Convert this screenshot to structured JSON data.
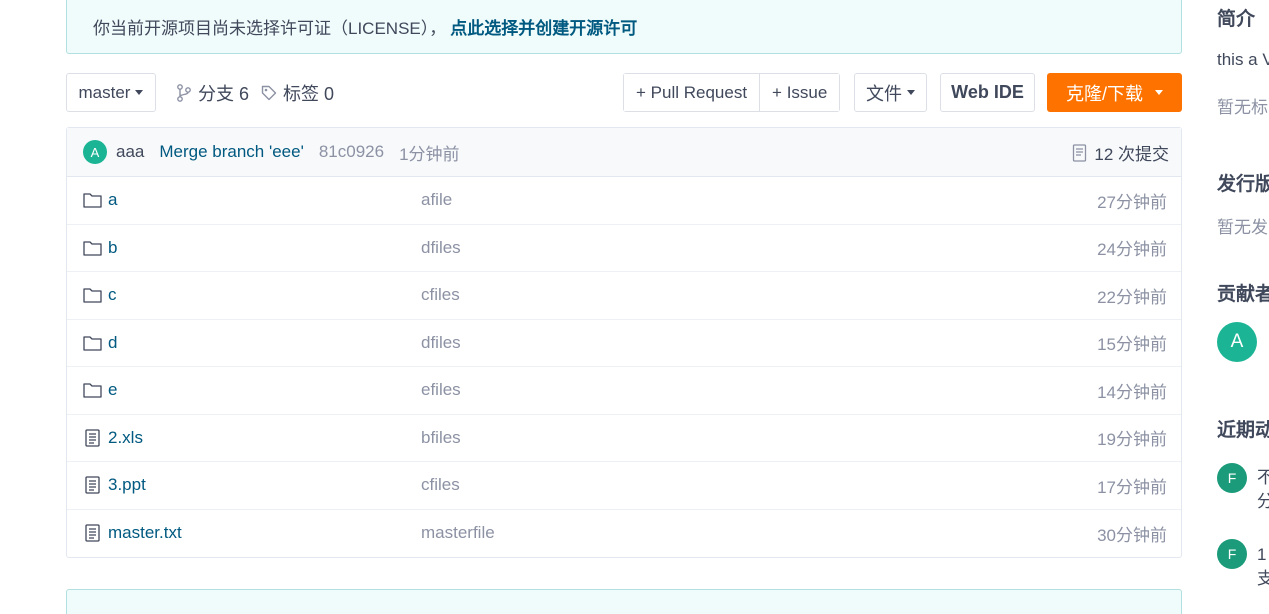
{
  "license_banner": {
    "message": "你当前开源项目尚未选择许可证（LICENSE），",
    "link": "点此选择并创建开源许可"
  },
  "toolbar": {
    "branch": "master",
    "branches_label": "分支 6",
    "tags_label": "标签 0",
    "pull_request": "+ Pull Request",
    "issue": "+ Issue",
    "file": "文件",
    "web_ide": "Web IDE",
    "clone": "克隆/下载"
  },
  "latest_commit": {
    "avatar": "A",
    "author": "aaa",
    "message": "Merge branch 'eee'",
    "sha": "81c0926",
    "time": "1分钟前",
    "count": "12 次提交"
  },
  "files": [
    {
      "name": "a",
      "type": "folder",
      "commit": "afile",
      "time": "27分钟前"
    },
    {
      "name": "b",
      "type": "folder",
      "commit": "dfiles",
      "time": "24分钟前"
    },
    {
      "name": "c",
      "type": "folder",
      "commit": "cfiles",
      "time": "22分钟前"
    },
    {
      "name": "d",
      "type": "folder",
      "commit": "dfiles",
      "time": "15分钟前"
    },
    {
      "name": "e",
      "type": "folder",
      "commit": "efiles",
      "time": "14分钟前"
    },
    {
      "name": "2.xls",
      "type": "file",
      "commit": "bfiles",
      "time": "19分钟前"
    },
    {
      "name": "3.ppt",
      "type": "file",
      "commit": "cfiles",
      "time": "17分钟前"
    },
    {
      "name": "master.txt",
      "type": "file",
      "commit": "masterfile",
      "time": "30分钟前"
    }
  ],
  "sidebar": {
    "intro_title": "简介",
    "intro_text": "this a V",
    "tags_text": "暂无标",
    "release_title": "发行版",
    "release_text": "暂无发",
    "contributors_title": "贡献者",
    "contributor_avatar": "A",
    "activity_title": "近期动",
    "activities": [
      {
        "avatar": "F",
        "line1": "不",
        "line2": "分"
      },
      {
        "avatar": "F",
        "line1": "1",
        "line2": "支"
      }
    ]
  },
  "colors": {
    "accent": "#fe7300",
    "link": "#005980",
    "avatar": "#1bb595"
  }
}
